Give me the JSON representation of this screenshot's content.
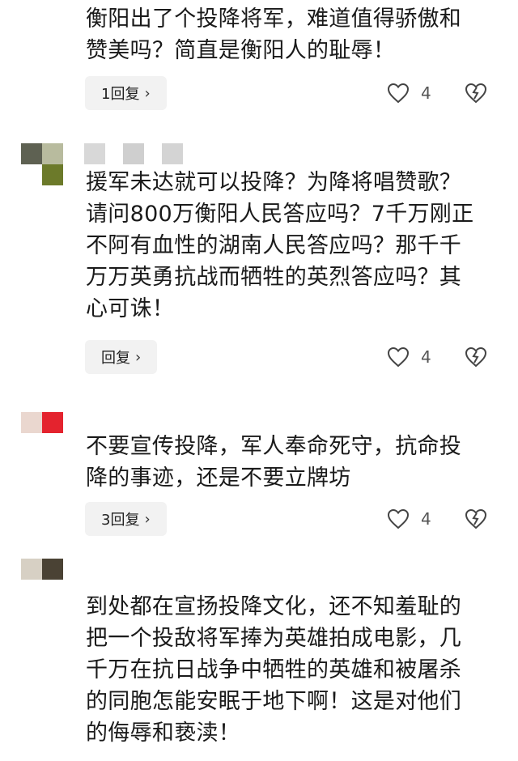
{
  "comments": [
    {
      "text": "衡阳出了个投降将军，难道值得骄傲和\n赞美吗？简直是衡阳人的耻辱！",
      "reply_label": "1回复",
      "likes": "4",
      "avatar_colors": [
        "#ffffff",
        "#5b4fd0",
        "#ffffff",
        "#ffffff"
      ]
    },
    {
      "text": "援军未达就可以投降？为降将唱赞歌？\n请问800万衡阳人民答应吗？7千万刚正\n不阿有血性的湖南人民答应吗？那千千\n万万英勇抗战而牺牲的英烈答应吗？其\n心可诛！",
      "reply_label": "回复",
      "likes": "4",
      "avatar_colors": [
        "#5e6152",
        "#b8bb9e",
        "#ffffff",
        "#6c7a2a"
      ],
      "username_colors": [
        "#d8d8d8",
        "#cfcfcf",
        "#d4d4d4"
      ]
    },
    {
      "text": "不要宣传投降，军人奉命死守，抗命投\n降的事迹，还是不要立牌坊",
      "reply_label": "3回复",
      "likes": "4",
      "avatar_colors": [
        "#ead7cf",
        "#e4232e",
        "#ffffff",
        "#ffffff"
      ]
    },
    {
      "text": "到处都在宣扬投降文化，还不知羞耻的\n把一个投敌将军捧为英雄拍成电影，几\n千万在抗日战争中牺牲的英雄和被屠杀\n的同胞怎能安眠于地下啊！这是对他们\n的侮辱和亵渎！",
      "avatar_colors": [
        "#d7d0c4",
        "#4a4234",
        "#ffffff",
        "#ffffff"
      ]
    }
  ]
}
